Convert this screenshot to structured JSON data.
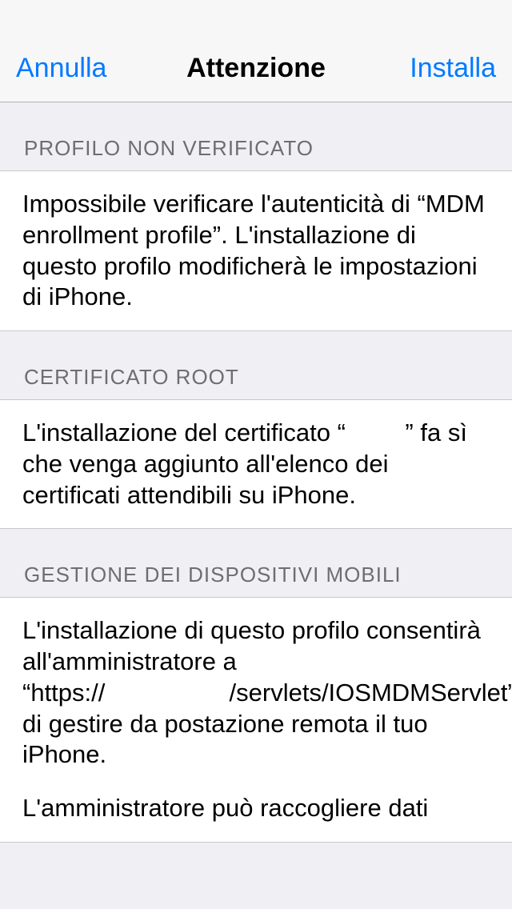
{
  "navbar": {
    "cancel": "Annulla",
    "title": "Attenzione",
    "install": "Installa"
  },
  "sections": {
    "unverified": {
      "header": "PROFILO NON VERIFICATO",
      "body": "Impossibile verificare l'autenticità di “MDM enrollment profile”. L'installazione di questo profilo modificherà le impostazioni di iPhone."
    },
    "root": {
      "header": "CERTIFICATO ROOT",
      "body": "L'installazione del certificato “            ” fa sì che venga aggiunto all'elenco dei certificati attendibili su iPhone."
    },
    "mdm": {
      "header": "GESTIONE DEI DISPOSITIVI MOBILI",
      "body1": "L'installazione di questo profilo consentirà all'amministratore a “https://                         /servlets/IOSMDMServlet” di gestire da postazione remota il tuo iPhone.",
      "body2": "L'amministratore può raccogliere dati"
    }
  }
}
